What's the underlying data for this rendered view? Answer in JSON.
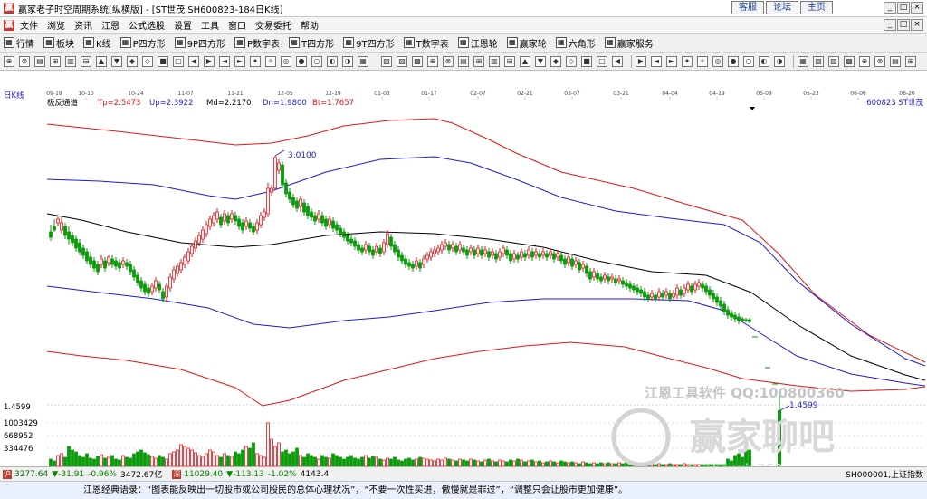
{
  "window": {
    "title": "赢家老子时空周期系统[纵横版] - [ST世茂  SH600823-184日K线]",
    "links": [
      "客服",
      "论坛",
      "主页"
    ],
    "controls": [
      "_",
      "□",
      "×"
    ]
  },
  "menu": {
    "items": [
      "文件",
      "浏览",
      "资讯",
      "江恩",
      "公式选股",
      "设置",
      "工具",
      "窗口",
      "交易委托",
      "帮助"
    ],
    "controls": [
      "_",
      "□",
      "×"
    ]
  },
  "toolbar": {
    "items": [
      "行情",
      "板块",
      "K线",
      "P四方形",
      "9P四方形",
      "P数字表",
      "T四方形",
      "9T四方形",
      "T数字表",
      "江恩轮",
      "赢家轮",
      "六角形",
      "赢家服务"
    ]
  },
  "chart_panel": {
    "period_label": "日K线",
    "indicator": "极反通道",
    "tp": "Tp=2.5473",
    "up": "Up=2.3922",
    "md": "Md=2.2170",
    "dn": "Dn=1.9800",
    "bt": "Bt=1.7657",
    "stock": "600823  ST世茂",
    "peak_label": "3.0100",
    "low_label": "1.4599",
    "price_axis_label": "1.4599",
    "vol_axis": [
      "1003429",
      "668952",
      "334476"
    ],
    "date_ticks": [
      "09-19",
      "10-10",
      "10-24",
      "11-07",
      "11-21",
      "12-05",
      "12-19",
      "01-03",
      "01-17",
      "02-07",
      "02-21",
      "03-07",
      "03-21",
      "04-04",
      "04-19",
      "05-09",
      "05-23",
      "06-06",
      "06-20"
    ],
    "watermark_line1": "江恩工具软件  QQ:100800360",
    "watermark_line2": "赢家聊吧",
    "watermark_line3": "liaoba.win360",
    "colors": {
      "up": "#e8141a",
      "down": "#0a9a0a",
      "outer_band": "#e51414",
      "inner_band": "#1c1cd6",
      "mid": "#000000"
    }
  },
  "chart_data": {
    "type": "candlestick",
    "title": "ST世茂 SH600823 日K线",
    "candles_note": "approx. daily OHLC read from chart; open/close/high/low in price units",
    "series": [
      {
        "name": "极反通道 Tp",
        "values_at_dates": {
          "09-19": 2.55,
          "12-05": 2.78,
          "01-17": 2.7,
          "02-21": 2.6,
          "04-19": 2.28,
          "06-20": 1.79
        }
      },
      {
        "name": "极反通道 Up",
        "values_at_dates": {
          "09-19": 2.34,
          "12-05": 2.5,
          "01-17": 2.47,
          "02-21": 2.38,
          "04-19": 2.05,
          "06-20": 1.75
        }
      },
      {
        "name": "极反通道 Md",
        "values_at_dates": {
          "09-19": 2.21,
          "12-05": 2.26,
          "01-17": 2.25,
          "02-21": 2.24,
          "04-19": 1.97,
          "06-20": 1.74
        }
      },
      {
        "name": "极反通道 Dn",
        "values_at_dates": {
          "09-19": 1.99,
          "12-05": 1.96,
          "01-17": 2.04,
          "02-21": 2.08,
          "04-19": 1.86,
          "06-20": 1.73
        }
      },
      {
        "name": "极反通道 Bt",
        "values_at_dates": {
          "09-19": 1.79,
          "12-05": 1.64,
          "01-17": 1.75,
          "02-21": 1.85,
          "04-19": 1.83,
          "06-20": 1.72
        }
      }
    ],
    "annotations": [
      {
        "text": "3.0100",
        "at": "12-05"
      },
      {
        "text": "1.4599",
        "at": "05-09"
      }
    ]
  },
  "status": {
    "sh_index": "3277.64",
    "sh_change": "▼-31.91",
    "sh_pct": "-0.96%",
    "sh_amount": "3472.67亿",
    "sz_index": "11029.40",
    "sz_change": "▼-113.13",
    "sz_pct": "-1.02%",
    "sz_amount": "4143.4",
    "right": "SH000001,上证指数"
  },
  "slogan": "江恩经典语录：“图表能反映出一切股市或公司股民的总体心理状况”，“不要一次性买进，傲慢就是罪过”，“调整只会让股市更加健康”。"
}
